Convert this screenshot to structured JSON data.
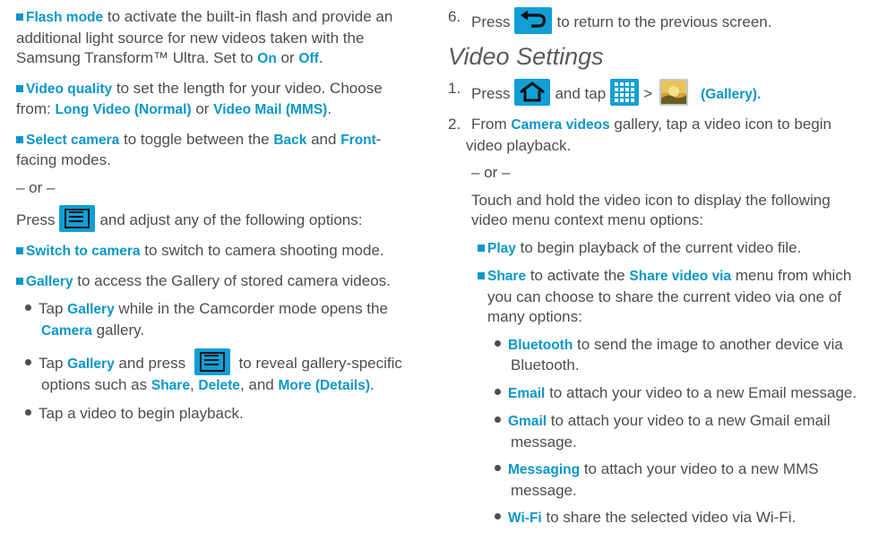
{
  "left": {
    "flash_term": "Flash mode",
    "flash_desc1": " to activate the built-in flash and provide an additional light source for new videos taken with the Samsung Transform™ Ultra. Set to ",
    "on": "On",
    "or1": " or ",
    "off": "Off",
    "period1": ".",
    "vq_term": "Video quality",
    "vq_desc": " to set the length for your video. Choose from: ",
    "long_video": "Long Video (Normal)",
    "or2": " or ",
    "video_mail": "Video Mail (MMS)",
    "period2": ".",
    "sc_term": "Select camera",
    "sc_desc1": " to toggle between the ",
    "back": "Back",
    "and1": " and ",
    "front": "Front",
    "sc_desc2": "-facing modes.",
    "or_line": "– or –",
    "press": "Press",
    "press_desc": "and adjust any of the following options:",
    "stc_term": "Switch to camera",
    "stc_desc": " to switch to camera shooting mode.",
    "gallery_term": "Gallery",
    "gallery_desc": " to access the Gallery of stored camera videos.",
    "tap1": "Tap ",
    "gallery1": "Gallery",
    "tap1_desc": " while in the Camcorder mode opens the ",
    "camera": "Camera",
    "tap1_end": " gallery.",
    "tap2": "Tap ",
    "gallery2": "Gallery",
    "tap2_mid": " and press ",
    "tap2_desc": " to reveal gallery-specific options such as ",
    "share": "Share",
    "comma": ", ",
    "delete": "Delete",
    "and2": ", and ",
    "more": "More (Details)",
    "period3": ".",
    "tap3": "Tap a video to begin playback."
  },
  "right": {
    "step6_num": "6.",
    "step6_press": "Press",
    "step6_desc": "to return to the previous screen.",
    "heading": "Video Settings",
    "step1_num": "1.",
    "step1_press": "Press",
    "step1_tap": "and tap",
    "gt": ">",
    "gallery_paren": "(Gallery).",
    "step2_num": "2.",
    "step2_from": "From ",
    "camera_videos": "Camera videos",
    "step2_desc": " gallery, tap a video icon to begin video playback.",
    "or_line": "– or –",
    "touch": "Touch and hold the video icon to display the following video menu context menu options:",
    "play_term": "Play",
    "play_desc": " to begin playback of the current video file.",
    "share_term": "Share",
    "share_desc1": " to activate the ",
    "share_via": "Share video via",
    "share_desc2": " menu from which you can choose to share the current video via one of many options:",
    "bt_term": "Bluetooth",
    "bt_desc": " to send the image to another device via Bluetooth.",
    "email_term": "Email",
    "email_desc": " to attach your video to a new Email message.",
    "gmail_term": "Gmail",
    "gmail_desc": " to attach your video to a new Gmail email message.",
    "msg_term": "Messaging",
    "msg_desc": " to attach your video to a new MMS message.",
    "wifi_term": "Wi-Fi",
    "wifi_desc": " to share the selected video via Wi-Fi."
  },
  "icons": {
    "menu": "menu-icon",
    "back": "back-arrow-icon",
    "home": "home-icon",
    "apps": "apps-grid-icon",
    "gallery": "gallery-icon"
  },
  "colors": {
    "term": "#0a97c9",
    "icon_bg": "#119fd6",
    "text": "#4d4d4d"
  }
}
